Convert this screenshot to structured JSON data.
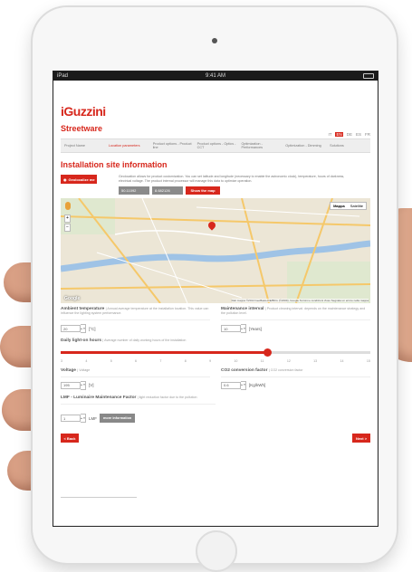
{
  "device": {
    "status_left": "iPad",
    "status_time": "9:41 AM"
  },
  "header": {
    "logo": "iGuzzini",
    "languages": [
      {
        "label": "IT",
        "active": false
      },
      {
        "label": "EN",
        "active": true
      },
      {
        "label": "DE",
        "active": false
      },
      {
        "label": "ES",
        "active": false
      },
      {
        "label": "FR",
        "active": false
      }
    ]
  },
  "product_title": "Streetware",
  "tabs": [
    {
      "label": "Project Name",
      "active": false
    },
    {
      "label": "Location parameters",
      "active": true
    },
    {
      "label": "Product options - Product line",
      "active": false
    },
    {
      "label": "Product options - Optics - CCT",
      "active": false
    },
    {
      "label": "Optimization - Performances",
      "active": false
    },
    {
      "label": "Optimization - Dimming",
      "active": false
    },
    {
      "label": "Solutions",
      "active": false
    }
  ],
  "section_title": "Installation site information",
  "geolocalize": {
    "button_label": "Geolocalize me",
    "description": "Geolocation allows for product customization. You can set latitude and longitude (necessary to enable the astronomic clock), temperature, hours of darkness, electrical voltage. The product internal processor will manage this data to optimize operation.",
    "latitude": "50.11092",
    "longitude": "8.682126",
    "show_map_label": "Show the map"
  },
  "map": {
    "type_options": [
      "Mappa",
      "Satellite"
    ],
    "attribution": "Dati mappa ©2014 GeoBasis-DE/BKG (©2009), Google   Termini e condizioni d'uso   Segnala un errore nella mappa",
    "brand": "Google"
  },
  "ambient": {
    "label": "Ambient temperature",
    "sub": "| Annual average temperature at the installation location. This value can influence the lighting system performance.",
    "value": "20",
    "unit": "[°C]"
  },
  "maintenance": {
    "label": "Maintenance interval",
    "sub": "| Product cleaning interval: depends on the maintenance strategy and the pollution level.",
    "value": "10",
    "unit": "[Years]"
  },
  "daylight": {
    "label": "Daily light-on hours",
    "sub": "| Average number of daily working hours of the installation",
    "min": 3,
    "max": 15,
    "value": 11,
    "ticks": [
      "3",
      "4",
      "5",
      "6",
      "7",
      "8",
      "9",
      "10",
      "11",
      "12",
      "13",
      "14",
      "15"
    ]
  },
  "voltage": {
    "label": "Voltage",
    "sub": "| Voltage",
    "value": "195",
    "unit": "[V]"
  },
  "co2": {
    "label": "CO2 conversion factor",
    "sub": "| CO2 conversion factor",
    "value": "0.6",
    "unit": "[Kg/kWh]"
  },
  "lmf": {
    "label": "LMF - Luminaire Maintenance Factor",
    "sub": "| light reduction factor due to the pollution",
    "value": "1",
    "unit": "LMF",
    "more_label": "more information"
  },
  "nav": {
    "back_label": "< Back",
    "next_label": "Next >"
  },
  "colors": {
    "brand_red": "#d7271c"
  }
}
